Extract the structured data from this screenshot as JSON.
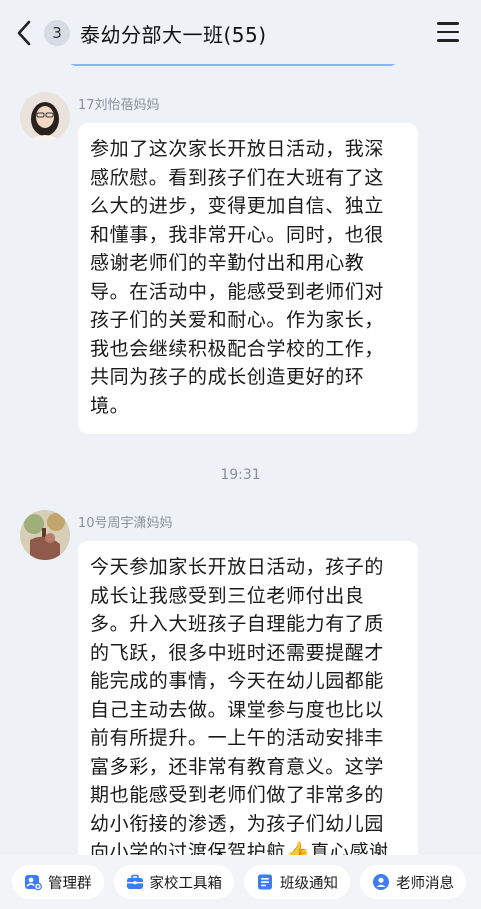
{
  "header": {
    "unread_count": "3",
    "title": "泰幼分部大一班(55)"
  },
  "messages": [
    {
      "sender": "17刘怡蓓妈妈",
      "text": "参加了这次家长开放日活动，我深感欣慰。看到孩子们在大班有了这么大的进步，变得更加自信、独立和懂事，我非常开心。同时，也很感谢老师们的辛勤付出和用心教导。在活动中，能感受到老师们对孩子们的关爱和耐心。作为家长，我也会继续积极配合学校的工作，共同为孩子的成长创造更好的环境。"
    },
    {
      "sender": "10号周宇潇妈妈",
      "text": "今天参加家长开放日活动，孩子的成长让我感受到三位老师付出良多。升入大班孩子自理能力有了质的飞跃，很多中班时还需要提醒才能完成的事情，今天在幼儿园都能自己主动去做。课堂参与度也比以前有所提升。一上午的活动安排丰富多彩，还非常有教育意义。这学期也能感受到老师们做了非常多的幼小衔接的渗透，为孩子们幼儿园向小学的过渡保驾护航👍真心感谢"
    }
  ],
  "timestamp": "19:31",
  "toolbar": {
    "items": [
      {
        "label": "管理群",
        "icon": "manage-group-icon"
      },
      {
        "label": "家校工具箱",
        "icon": "toolbox-icon"
      },
      {
        "label": "班级通知",
        "icon": "notice-icon"
      },
      {
        "label": "老师消息",
        "icon": "teacher-message-icon"
      }
    ]
  },
  "colors": {
    "background": "#eef1f6",
    "bubble": "#ffffff",
    "muted_text": "#8a8f98",
    "toolbar_blue": "#3d7bf7"
  }
}
